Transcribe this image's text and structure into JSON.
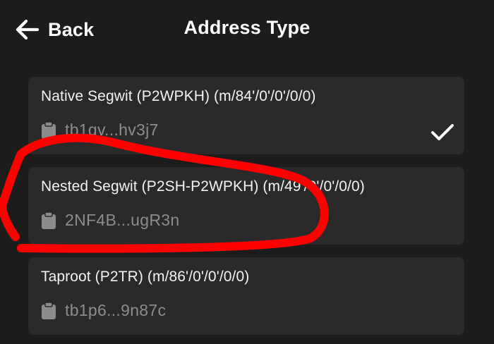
{
  "header": {
    "back_label": "Back",
    "title": "Address Type"
  },
  "options": [
    {
      "label": "Native Segwit (P2WPKH) (m/84'/0'/0'/0/0)",
      "address": "tb1qv...hv3j7",
      "selected": true
    },
    {
      "label": "Nested Segwit (P2SH-P2WPKH) (m/49'/0'/0'/0/0)",
      "address": "2NF4B...ugR3n",
      "selected": false
    },
    {
      "label": "Taproot (P2TR) (m/86'/0'/0'/0/0)",
      "address": "tb1p6...9n87c",
      "selected": false
    }
  ],
  "icons": {
    "back": "arrow-left-icon",
    "address": "clipboard-icon",
    "selected": "checkmark-icon"
  },
  "colors": {
    "background": "#1c1c1c",
    "card": "#2a2a2a",
    "address_text": "#8c8c8c",
    "annotation": "#ff0000"
  }
}
